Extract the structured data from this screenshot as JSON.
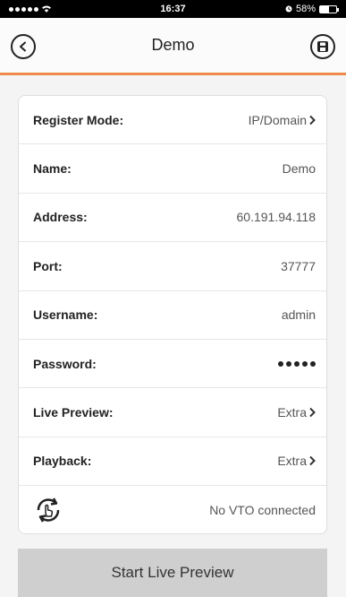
{
  "status_bar": {
    "time": "16:37",
    "battery": "58%",
    "battery_level": 0.58
  },
  "nav": {
    "title": "Demo"
  },
  "fields": {
    "register_mode": {
      "label": "Register Mode:",
      "value": "IP/Domain"
    },
    "name": {
      "label": "Name:",
      "value": "Demo"
    },
    "address": {
      "label": "Address:",
      "value": "60.191.94.118"
    },
    "port": {
      "label": "Port:",
      "value": "37777"
    },
    "username": {
      "label": "Username:",
      "value": "admin"
    },
    "password": {
      "label": "Password:"
    },
    "live_preview": {
      "label": "Live Preview:",
      "value": "Extra"
    },
    "playback": {
      "label": "Playback:",
      "value": "Extra"
    },
    "vto": {
      "value": "No VTO connected"
    }
  },
  "actions": {
    "start_live_preview": "Start Live Preview"
  },
  "colors": {
    "accent": "#f08a4b",
    "button_bg": "#cfcfcf"
  }
}
